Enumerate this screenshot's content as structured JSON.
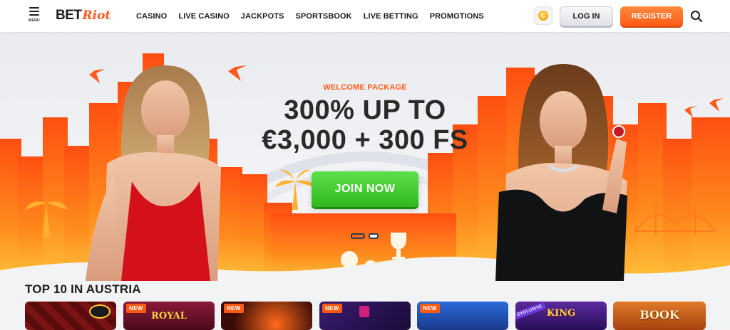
{
  "header": {
    "menu_label": "MENU",
    "logo": {
      "part1": "BET",
      "part2": "Riot"
    },
    "nav": [
      "CASINO",
      "LIVE CASINO",
      "JACKPOTS",
      "SPORTSBOOK",
      "LIVE BETTING",
      "PROMOTIONS"
    ],
    "login_label": "LOG IN",
    "register_label": "REGISTER",
    "bonus_icon_glyph": "C"
  },
  "hero": {
    "welcome": "WELCOME PACKAGE",
    "headline_line1": "300% UP TO",
    "headline_line2": "€3,000 + 300 FS",
    "cta_label": "JOIN NOW",
    "slides": 2,
    "active_slide": 1
  },
  "section": {
    "title": "TOP 10 IN AUSTRIA"
  },
  "games": [
    {
      "tag": "",
      "name": "",
      "bg": "#7a1414"
    },
    {
      "tag": "NEW",
      "name": "ROYAL",
      "bg": "#5a0f25"
    },
    {
      "tag": "NEW",
      "name": "",
      "bg": "#3a0c08"
    },
    {
      "tag": "NEW",
      "name": "",
      "bg": "#2c1456"
    },
    {
      "tag": "NEW",
      "name": "",
      "bg": "#1e4fa8"
    },
    {
      "tag": "EXCLUSIVE",
      "name": "KING",
      "bg": "#3b1b6e"
    },
    {
      "tag": "",
      "name": "BOOK",
      "bg": "#c45a1a"
    }
  ],
  "colors": {
    "accent": "#ff5a14",
    "cta": "#3cc628",
    "text_dark": "#2a2a2a"
  }
}
